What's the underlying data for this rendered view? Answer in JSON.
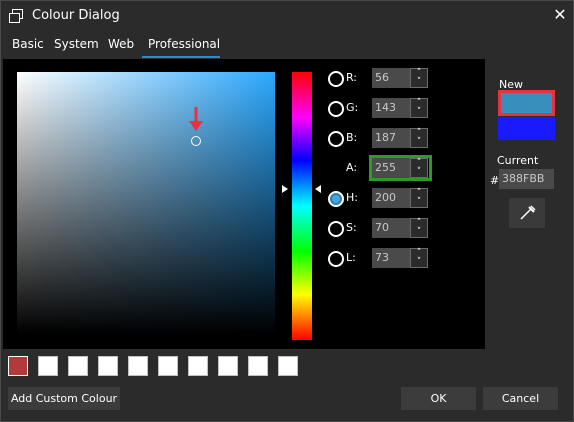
{
  "window": {
    "title": "Colour Dialog",
    "close_glyph": "✕"
  },
  "tabs": [
    {
      "label": "Basic",
      "active": false
    },
    {
      "label": "System",
      "active": false
    },
    {
      "label": "Web",
      "active": false
    },
    {
      "label": "Professional",
      "active": true
    }
  ],
  "channels": {
    "r": {
      "label": "R:",
      "value": "56"
    },
    "g": {
      "label": "G:",
      "value": "143"
    },
    "b": {
      "label": "B:",
      "value": "187"
    },
    "a": {
      "label": "A:",
      "value": "255"
    },
    "h": {
      "label": "H:",
      "value": "200",
      "selected": true
    },
    "s": {
      "label": "S:",
      "value": "70"
    },
    "l": {
      "label": "L:",
      "value": "73"
    }
  },
  "preview": {
    "new_label": "New",
    "current_label": "Current",
    "hash": "#",
    "hex_value": "388FBB",
    "new_color": "#388fbb",
    "current_color": "#1a1aff"
  },
  "custom_swatches": {
    "filled_color": "#b23a3a",
    "count_empty": 9
  },
  "buttons": {
    "add_custom": "Add Custom Colour",
    "ok": "OK",
    "cancel": "Cancel"
  },
  "icons": {
    "app": "window-restore-icon",
    "close": "close-icon",
    "spin_up": "chevron-up-icon",
    "spin_down": "chevron-down-icon",
    "dropper": "eyedropper-icon"
  }
}
